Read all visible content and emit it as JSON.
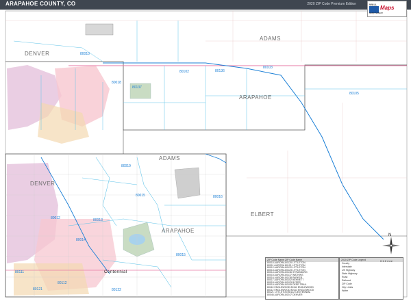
{
  "header": {
    "title": "ARAPAHOE COUNTY, CO",
    "subtitle": "2020 ZIP Code Premium Edition"
  },
  "logo": {
    "line1": "WALL",
    "brand": "Maps",
    "line3": "Map Maker"
  },
  "places": {
    "denver": "DENVER",
    "adams": "ADAMS",
    "arapahoe": "ARAPAHOE",
    "elbert": "ELBERT",
    "centennial": "Centennial"
  },
  "zips": [
    "80103",
    "80105",
    "80136",
    "80102",
    "80137",
    "80010",
    "80018",
    "80019",
    "80016",
    "80015",
    "80013",
    "80012",
    "80014",
    "80111",
    "80112",
    "80121",
    "80122",
    "80015"
  ],
  "legend": {
    "header": "ZIP Code  Name  ZIP Code  Name",
    "rows": [
      "80010  AURORA    80120  LITTLETON",
      "80011  AURORA    80121  LITTLETON",
      "80012  AURORA    80122  LITTLETON",
      "80013  AURORA    80123  LITTLETON",
      "80014  AURORA    80136  STRASBURG",
      "80015  AURORA    80137  WATKINS",
      "80016  AURORA    80138  PARKER",
      "80017  AURORA    80102  BENNETT",
      "80018  AURORA    80103  BYERS",
      "80019  AURORA    80105  DEER TRAIL",
      "80110  ENGLEWOOD 80111  ENGLEWOOD",
      "80112  ENGLEWOOD 80113  ENGLEWOOD",
      "80121  LITTLETON 80122  CENTENNIAL",
      "80046  AURORA    80247  DENVER",
      "80231  DENVER    80237  DENVER"
    ]
  },
  "key": {
    "header": "2020 ZIP Code Legend",
    "rows": [
      "County",
      "Interstate",
      "US Highway",
      "State Highway",
      "Road",
      "Railroad",
      "ZIP Code",
      "City Limits",
      "Water"
    ]
  },
  "compass": {
    "n": "N"
  },
  "scale": {
    "label": "0 1 2 4 mi"
  },
  "colors": {
    "zipline": "#5fc3e8",
    "road": "#d9a5a5",
    "county": "#555555",
    "highway": "#1a7fd6",
    "city_denver": "#e6c6de",
    "city_aurora": "#f7c7d0",
    "city_centennial": "#f3d9b0",
    "park": "#c9dcc3",
    "water": "#a8d2ec"
  }
}
